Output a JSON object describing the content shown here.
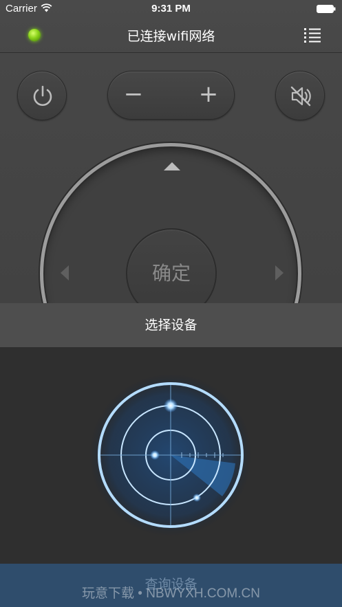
{
  "status_bar": {
    "carrier": "Carrier",
    "time": "9:31 PM"
  },
  "nav": {
    "title": "已连接wifi网络",
    "led_color": "#8ad21a",
    "menu_icon": "list-icon"
  },
  "remote": {
    "power_icon": "power-icon",
    "volume_down": "−",
    "volume_up": "+",
    "mute_icon": "speaker-muted-icon",
    "ok_label": "确定"
  },
  "device_sheet": {
    "header": "选择设备",
    "query_button": "查询设备",
    "radar_color": "#7ec8ff"
  },
  "watermark": "玩意下载 • NBWYXH.COM.CN"
}
